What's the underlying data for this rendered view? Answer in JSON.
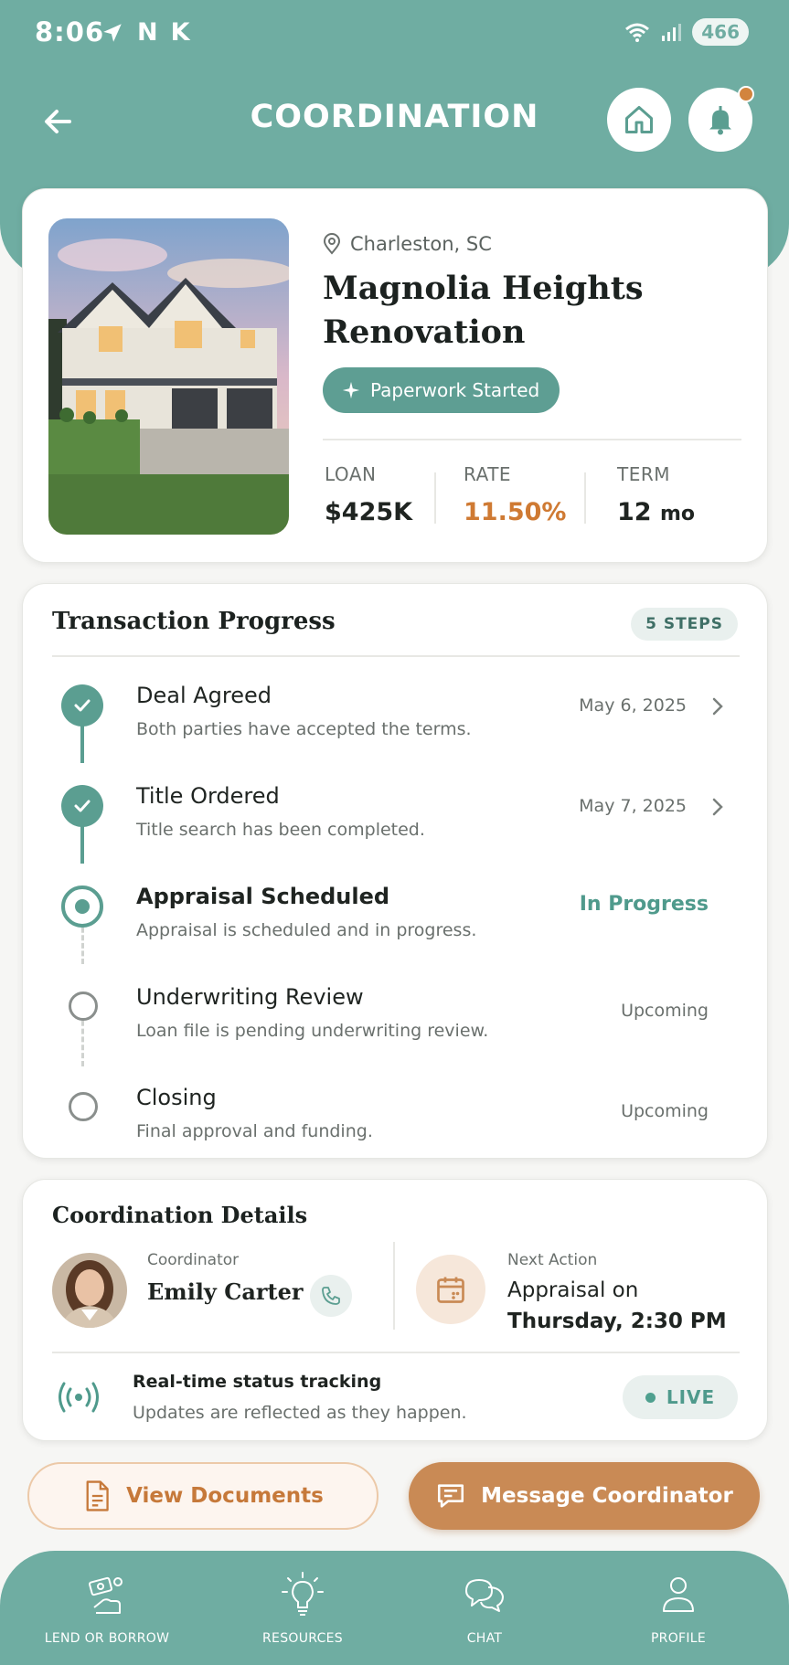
{
  "status_bar": {
    "time": "8:06",
    "glyphs": [
      "N",
      "K"
    ],
    "battery": "466"
  },
  "header": {
    "title": "COORDINATION"
  },
  "property": {
    "location": "Charleston, SC",
    "name": "Magnolia Heights Renovation",
    "status": "Paperwork Started",
    "stats": [
      {
        "label": "LOAN",
        "value": "$425K"
      },
      {
        "label": "RATE",
        "value": "11.50%"
      },
      {
        "label": "TERM",
        "value": "12",
        "unit": "mo"
      }
    ]
  },
  "progress": {
    "title": "Transaction Progress",
    "badge": "5 STEPS",
    "steps": [
      {
        "title": "Deal Agreed",
        "desc": "Both parties have accepted the terms.",
        "right": "May 6, 2025",
        "state": "done"
      },
      {
        "title": "Title Ordered",
        "desc": "Title search has been completed.",
        "right": "May 7, 2025",
        "state": "done"
      },
      {
        "title": "Appraisal Scheduled",
        "desc": "Appraisal is scheduled and in progress.",
        "right": "In Progress",
        "state": "current"
      },
      {
        "title": "Underwriting Review",
        "desc": "Loan file is pending underwriting review.",
        "right": "Upcoming",
        "state": "upcoming"
      },
      {
        "title": "Closing",
        "desc": "Final approval and funding.",
        "right": "Upcoming",
        "state": "upcoming"
      }
    ]
  },
  "coordination": {
    "title": "Coordination Details",
    "coordinator_label": "Coordinator",
    "coordinator_name": "Emily Carter",
    "next_action_label": "Next Action",
    "next_action_line1": "Appraisal on",
    "next_action_line2": "Thursday, 2:30 PM",
    "tracking_title": "Real-time status tracking",
    "tracking_sub": "Updates are reflected as they happen.",
    "live_label": "LIVE"
  },
  "actions": {
    "view_documents": "View Documents",
    "message_coordinator": "Message Coordinator"
  },
  "tabbar": {
    "items": [
      {
        "label": "LEND OR BORROW",
        "icon": "hand-money-icon"
      },
      {
        "label": "RESOURCES",
        "icon": "lightbulb-icon"
      },
      {
        "label": "CHAT",
        "icon": "chat-bubbles-icon"
      },
      {
        "label": "PROFILE",
        "icon": "person-icon"
      }
    ]
  },
  "colors": {
    "primary": "#6fada2",
    "accent": "#c98a55",
    "rate": "#cf7a33",
    "progress": "#4f9a8c"
  }
}
